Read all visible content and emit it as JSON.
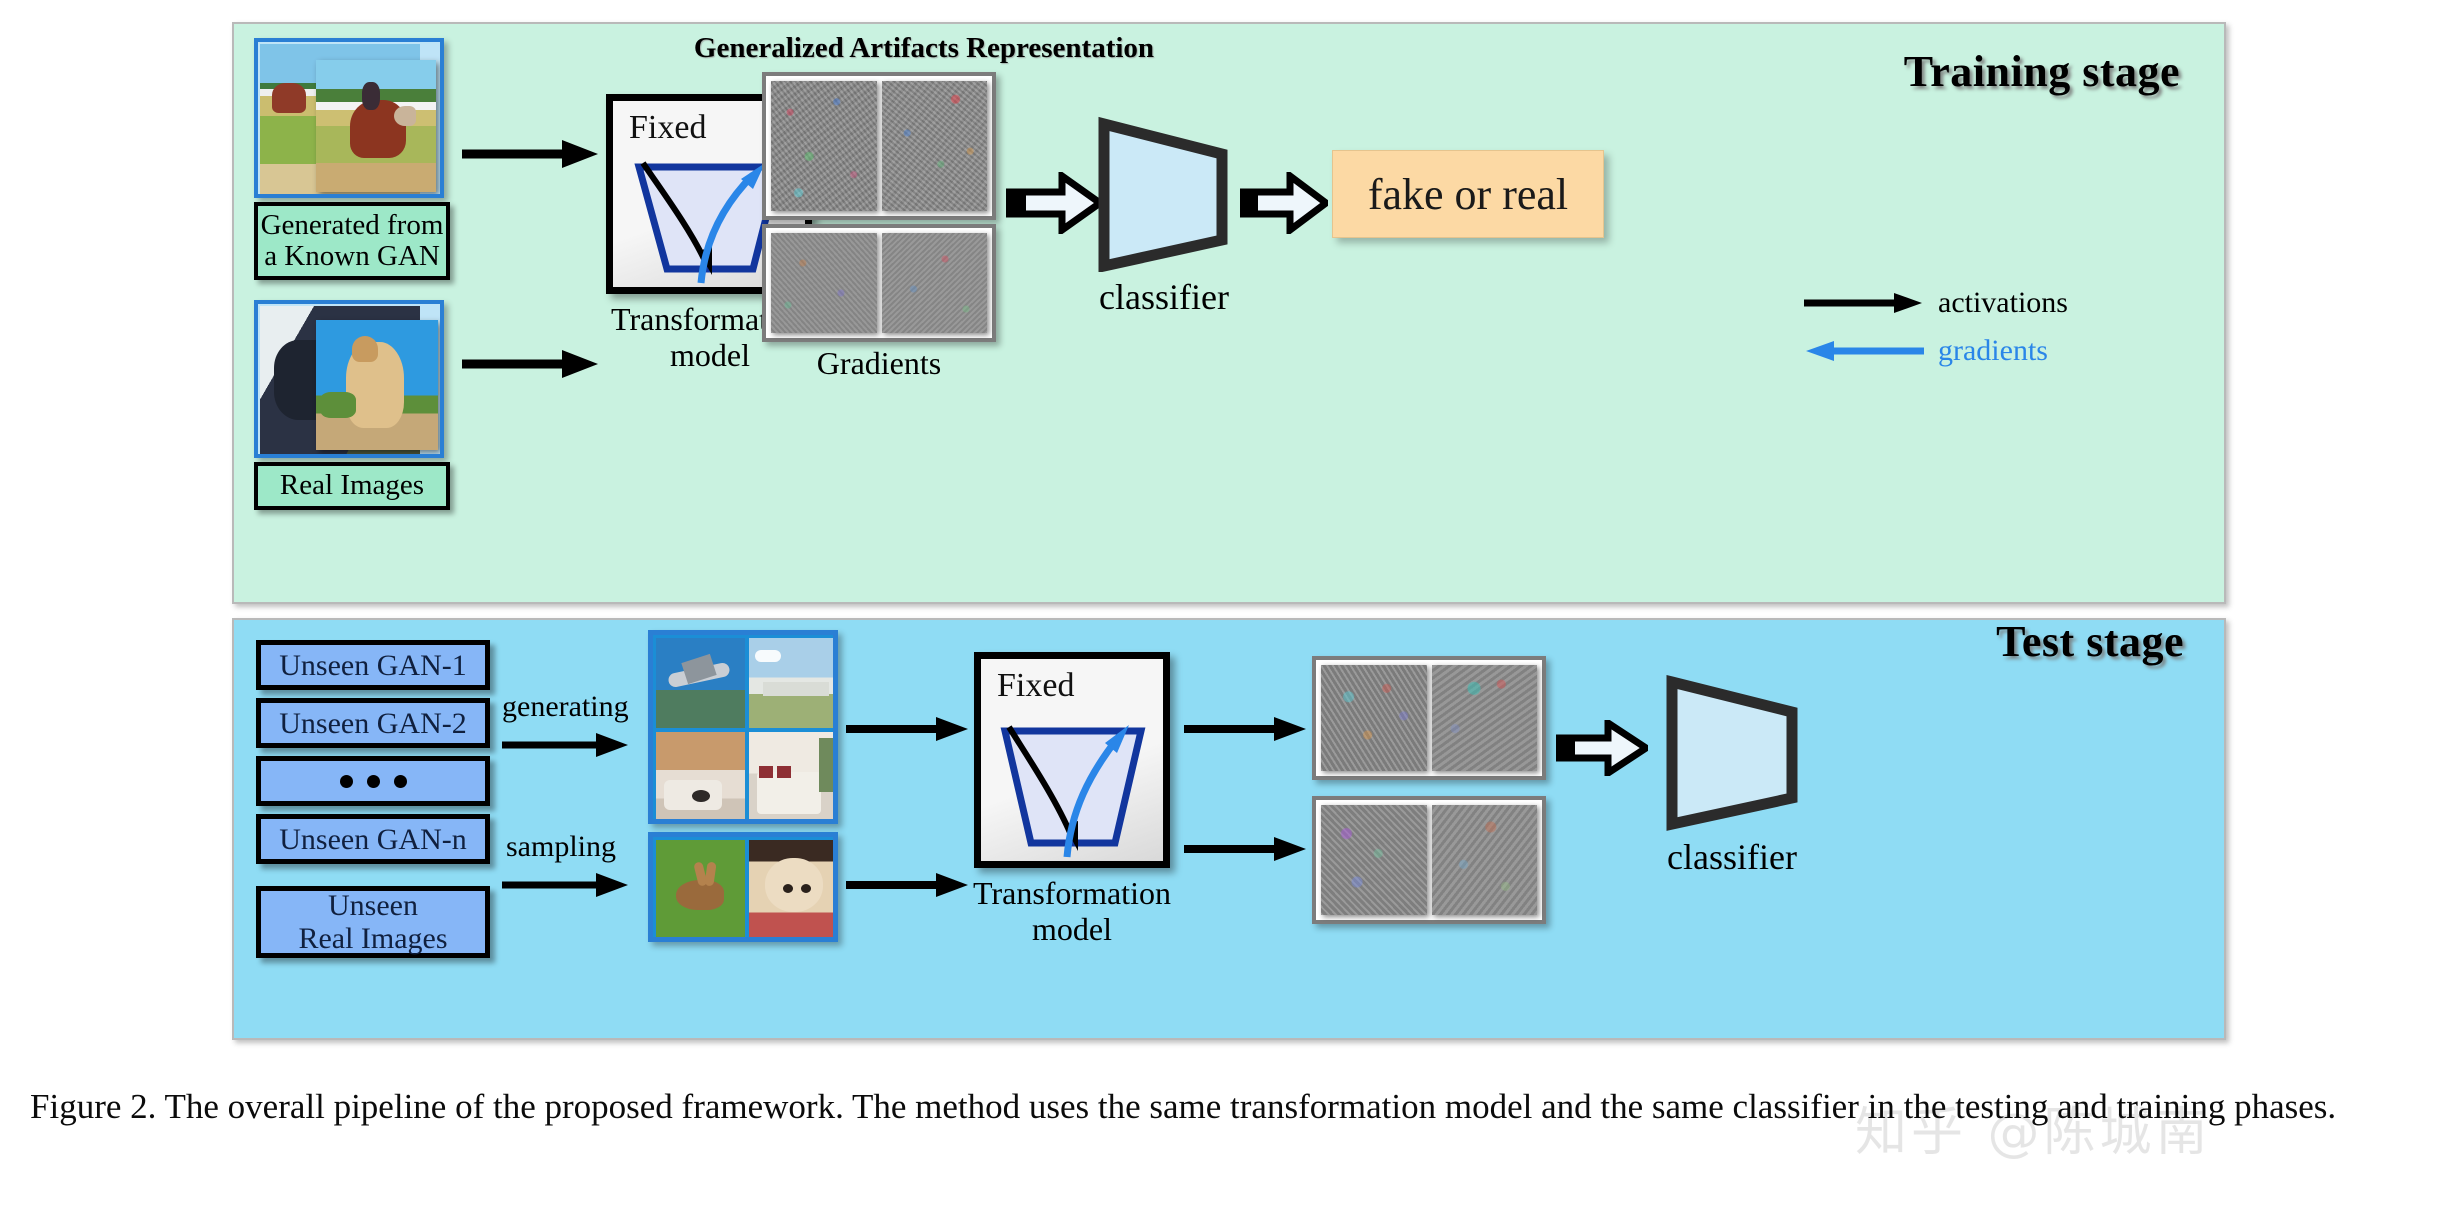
{
  "figure": {
    "caption": "Figure 2. The overall pipeline of the proposed framework. The method uses the same transformation model and the same classifier in the testing and training phases.",
    "watermark": "知乎 @陈城南"
  },
  "training_stage": {
    "title": "Training stage",
    "background_color": "#c9f2e0",
    "inputs": [
      {
        "label": "Generated from\na Known GAN",
        "name": "generated-known-gan"
      },
      {
        "label": "Real Images",
        "name": "real-images"
      }
    ],
    "transformation": {
      "fixed_label": "Fixed",
      "caption": "Transformation\nmodel"
    },
    "representation_title": "Generalized Artifacts Representation",
    "gradients_label": "Gradients",
    "classifier_label": "classifier",
    "result_label": "fake or real",
    "legend": [
      {
        "label": "activations",
        "color": "#000000",
        "direction": "right"
      },
      {
        "label": "gradients",
        "color": "#2a86e8",
        "direction": "left"
      }
    ]
  },
  "test_stage": {
    "title": "Test stage",
    "background_color": "#8fdcf4",
    "sources": [
      {
        "label": "Unseen GAN-1",
        "type": "text"
      },
      {
        "label": "Unseen GAN-2",
        "type": "text"
      },
      {
        "label": "",
        "type": "dots"
      },
      {
        "label": "Unseen GAN-n",
        "type": "text"
      },
      {
        "label": "Unseen\nReal Images",
        "type": "text"
      }
    ],
    "process_labels": [
      {
        "label": "generating"
      },
      {
        "label": "sampling"
      }
    ],
    "transformation": {
      "fixed_label": "Fixed",
      "caption": "Transformation\nmodel"
    },
    "classifier_label": "classifier"
  },
  "colors": {
    "training_bg": "#c9f2e0",
    "test_bg": "#8fdcf4",
    "classifier_fill": "#cbe9f7",
    "result_fill": "#fcd9a4",
    "gan_fill": "#86b6f7",
    "gradient_blue": "#2a86e8",
    "caption_chip": "#9de8c8"
  }
}
